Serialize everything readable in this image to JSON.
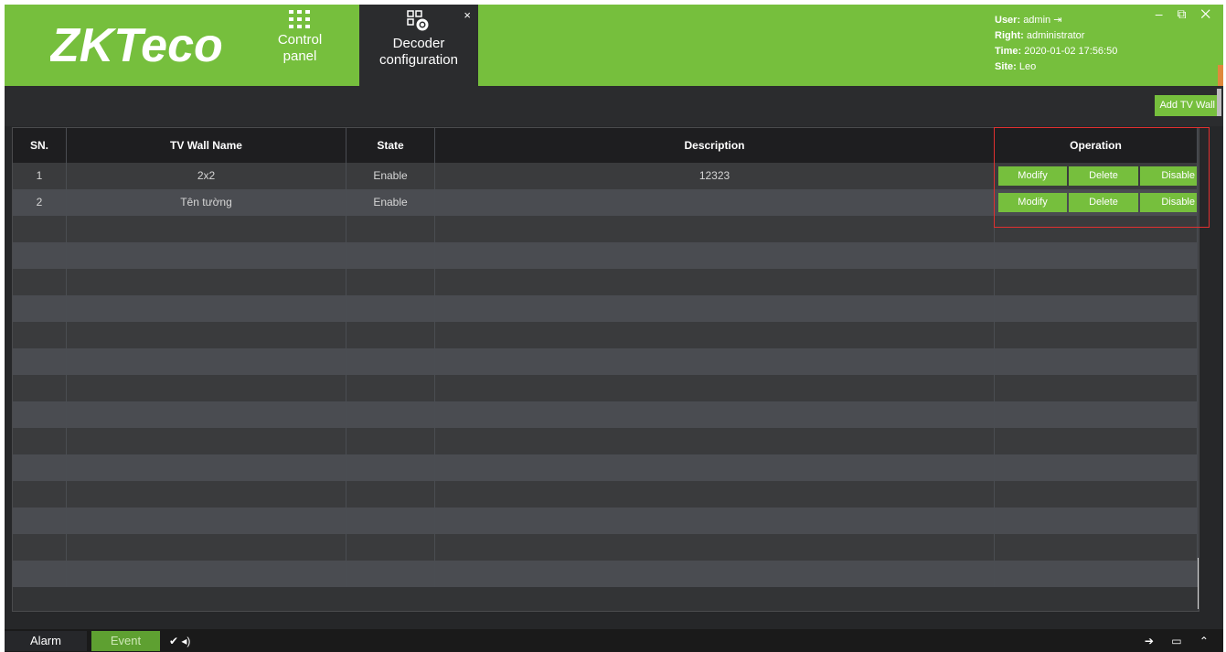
{
  "header": {
    "logo": "ZKTeco",
    "nav": [
      {
        "label_line1": "Control",
        "label_line2": "panel",
        "icon": "grid-icon"
      },
      {
        "label_line1": "Decoder",
        "label_line2": "configuration",
        "icon": "decoder-config-icon",
        "active": true
      }
    ],
    "tab_close": "×",
    "user": {
      "user_label": "User:",
      "user_value": "admin",
      "right_label": "Right:",
      "right_value": "administrator",
      "time_label": "Time:",
      "time_value": "2020-01-02 17:56:50",
      "site_label": "Site:",
      "site_value": "Leo"
    },
    "window_controls": "–  ⧉  ✕"
  },
  "toolbar": {
    "add_label": "Add TV Wall"
  },
  "table": {
    "headers": [
      "SN.",
      "TV Wall Name",
      "State",
      "Description",
      "Operation"
    ],
    "rows": [
      {
        "sn": "1",
        "name": "2x2",
        "state": "Enable",
        "description": "12323"
      },
      {
        "sn": "2",
        "name": "Tên tường",
        "state": "Enable",
        "description": ""
      }
    ],
    "ops": {
      "modify": "Modify",
      "delete": "Delete",
      "disable": "Disable"
    },
    "empty_rows": 14
  },
  "footer": {
    "alarm": "Alarm",
    "event": "Event",
    "icons": "✔ ◂)",
    "right_icons": "➔ ▭ ⌃"
  },
  "colors": {
    "accent": "#76bf3d",
    "dark": "#262729",
    "highlight": "#e03030"
  }
}
